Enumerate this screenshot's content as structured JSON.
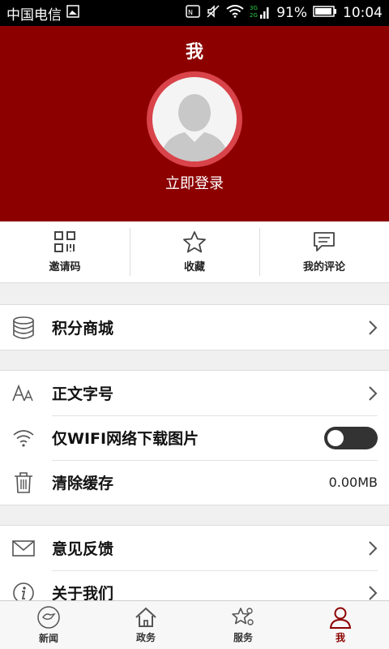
{
  "status_bar": {
    "carrier": "中国电信",
    "network_badge": "3G\n2G",
    "battery": "91%",
    "time": "10:04"
  },
  "profile": {
    "title": "我",
    "login": "立即登录"
  },
  "quick_actions": [
    {
      "label": "邀请码",
      "icon": "qr-code-icon"
    },
    {
      "label": "收藏",
      "icon": "star-icon"
    },
    {
      "label": "我的评论",
      "icon": "comment-icon"
    }
  ],
  "menu": {
    "points_mall": "积分商城",
    "font_size": "正文字号",
    "wifi_only_images": "仅WIFI网络下载图片",
    "clear_cache": "清除缓存",
    "cache_size": "0.00MB",
    "feedback": "意见反馈",
    "about": "关于我们"
  },
  "toggle_state": {
    "wifi_only_images": false
  },
  "tabs": [
    {
      "label": "新闻",
      "icon": "news-icon",
      "active": false
    },
    {
      "label": "政务",
      "icon": "home-icon",
      "active": false
    },
    {
      "label": "服务",
      "icon": "service-icon",
      "active": false
    },
    {
      "label": "我",
      "icon": "user-icon",
      "active": true
    }
  ],
  "colors": {
    "brand": "#8c0000",
    "avatar_ring": "#d9434a"
  }
}
